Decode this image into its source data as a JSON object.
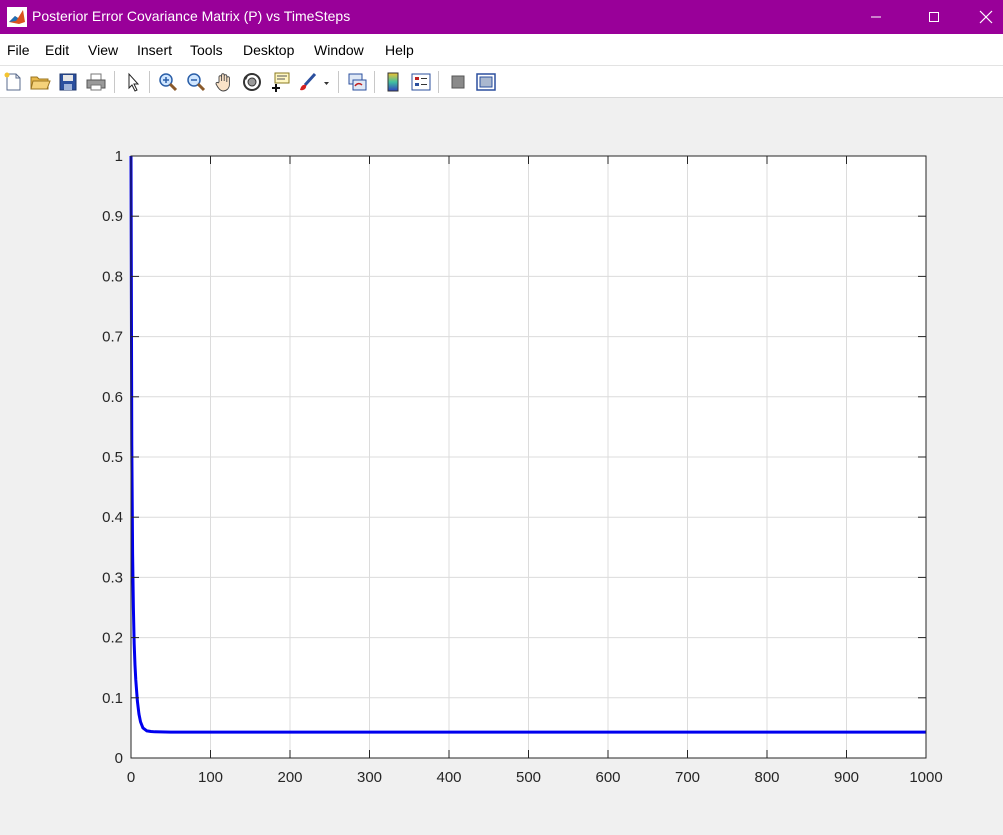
{
  "window": {
    "title": "Posterior Error Covariance Matrix (P) vs TimeSteps",
    "title_bar_color": "#990099",
    "controls": [
      "minimize-icon",
      "maximize-icon",
      "close-icon"
    ]
  },
  "menu": {
    "items": [
      "File",
      "Edit",
      "View",
      "Insert",
      "Tools",
      "Desktop",
      "Window",
      "Help"
    ]
  },
  "toolbar": {
    "tools": [
      "new-figure-icon",
      "open-file-icon",
      "save-icon",
      "print-icon",
      "edit-plot-arrow-icon",
      "zoom-in-icon",
      "zoom-out-icon",
      "pan-icon",
      "rotate-3d-icon",
      "data-cursor-icon",
      "brush-icon",
      "link-plot-icon",
      "insert-colorbar-icon",
      "insert-legend-icon",
      "hide-plot-tools-icon",
      "show-plot-tools-icon"
    ]
  },
  "chart_data": {
    "type": "line",
    "title": "",
    "xlabel": "",
    "ylabel": "",
    "xlim": [
      0,
      1000
    ],
    "ylim": [
      0,
      1
    ],
    "xticks": [
      "0",
      "100",
      "200",
      "300",
      "400",
      "500",
      "600",
      "700",
      "800",
      "900",
      "1000"
    ],
    "yticks": [
      "0",
      "0.1",
      "0.2",
      "0.3",
      "0.4",
      "0.5",
      "0.6",
      "0.7",
      "0.8",
      "0.9",
      "1"
    ],
    "grid": true,
    "line_color": "#0000ee",
    "series": [
      {
        "x": [
          0,
          1,
          2,
          3,
          4,
          5,
          6,
          8,
          10,
          12,
          15,
          20,
          25,
          30,
          50,
          100,
          200,
          400,
          600,
          800,
          1000
        ],
        "values": [
          1.0,
          0.52,
          0.34,
          0.25,
          0.19,
          0.155,
          0.13,
          0.095,
          0.073,
          0.06,
          0.05,
          0.045,
          0.044,
          0.0435,
          0.043,
          0.043,
          0.043,
          0.043,
          0.043,
          0.043,
          0.043
        ]
      }
    ]
  }
}
